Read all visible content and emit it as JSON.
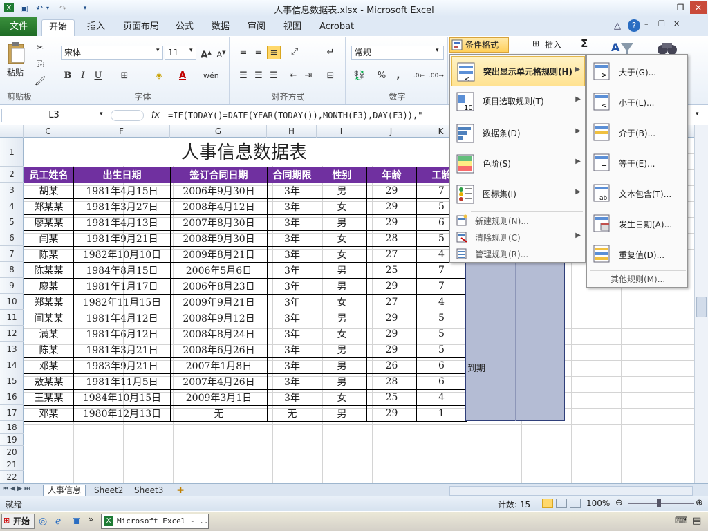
{
  "window": {
    "title": "人事信息数据表.xlsx - Microsoft Excel"
  },
  "ribbon_tabs": [
    "文件",
    "开始",
    "插入",
    "页面布局",
    "公式",
    "数据",
    "审阅",
    "视图",
    "Acrobat"
  ],
  "ribbon": {
    "paste_label": "粘贴",
    "clipboard_label": "剪贴板",
    "font_label": "字体",
    "align_label": "对齐方式",
    "number_label": "数字",
    "font_name": "宋体",
    "font_size": "11",
    "number_format": "常规",
    "cond_format_label": "条件格式",
    "insert_label": "插入",
    "sigma": "Σ",
    "bold": "B",
    "italic": "I",
    "underline": "U",
    "font_color": "A",
    "percent": "%",
    "comma": ","
  },
  "formula_bar": {
    "cell_ref": "L3",
    "fx": "fx",
    "formula": "=IF(TODAY()=DATE(YEAR(TODAY()),MONTH(F3),DAY(F3)),\""
  },
  "columns": [
    "C",
    "F",
    "G",
    "H",
    "I",
    "J",
    "K"
  ],
  "rows": [
    "1",
    "2",
    "3",
    "4",
    "5",
    "6",
    "7",
    "8",
    "9",
    "10",
    "11",
    "12",
    "13",
    "14",
    "15",
    "16",
    "17",
    "18",
    "19",
    "20",
    "21",
    "22"
  ],
  "sheet": {
    "title": "人事信息数据表",
    "headers": [
      "员工姓名",
      "出生日期",
      "签订合同日期",
      "合同期限",
      "性别",
      "年龄",
      "工龄"
    ],
    "rows": [
      [
        "胡某",
        "1981年4月15日",
        "2006年9月30日",
        "3年",
        "男",
        "29",
        "7"
      ],
      [
        "郑某某",
        "1981年3月27日",
        "2008年4月12日",
        "3年",
        "女",
        "29",
        "5"
      ],
      [
        "廖某某",
        "1981年4月13日",
        "2007年8月30日",
        "3年",
        "男",
        "29",
        "6"
      ],
      [
        "闫某",
        "1981年9月21日",
        "2008年9月30日",
        "3年",
        "女",
        "28",
        "5"
      ],
      [
        "陈某",
        "1982年10月10日",
        "2009年8月21日",
        "3年",
        "女",
        "27",
        "4"
      ],
      [
        "陈某某",
        "1984年8月15日",
        "2006年5月6日",
        "3年",
        "男",
        "25",
        "7"
      ],
      [
        "廖某",
        "1981年1月17日",
        "2006年8月23日",
        "3年",
        "男",
        "29",
        "7"
      ],
      [
        "郑某某",
        "1982年11月15日",
        "2009年9月21日",
        "3年",
        "女",
        "27",
        "4"
      ],
      [
        "闫某某",
        "1981年4月12日",
        "2008年9月12日",
        "3年",
        "男",
        "29",
        "5"
      ],
      [
        "满某",
        "1981年6月12日",
        "2008年8月24日",
        "3年",
        "女",
        "29",
        "5"
      ],
      [
        "陈某",
        "1981年3月21日",
        "2008年6月26日",
        "3年",
        "男",
        "29",
        "5"
      ],
      [
        "邓某",
        "1983年9月21日",
        "2007年1月8日",
        "3年",
        "男",
        "26",
        "6"
      ],
      [
        "敖某某",
        "1981年11月5日",
        "2007年4月26日",
        "3年",
        "男",
        "28",
        "6"
      ],
      [
        "王某某",
        "1984年10月15日",
        "2009年3月1日",
        "3年",
        "女",
        "25",
        "4"
      ],
      [
        "邓某",
        "1980年12月13日",
        "无",
        "无",
        "男",
        "29",
        "1"
      ]
    ],
    "overflow_text": "到期"
  },
  "menu_main": [
    {
      "label": "突出显示单元格规则(H)",
      "icon": "highlight-rules-icon"
    },
    {
      "label": "项目选取规则(T)",
      "icon": "top-bottom-rules-icon"
    },
    {
      "label": "数据条(D)",
      "icon": "data-bars-icon"
    },
    {
      "label": "色阶(S)",
      "icon": "color-scales-icon"
    },
    {
      "label": "图标集(I)",
      "icon": "icon-sets-icon"
    }
  ],
  "menu_small": [
    {
      "label": "新建规则(N)...",
      "icon": "new-rule-icon"
    },
    {
      "label": "清除规则(C)",
      "icon": "clear-rules-icon"
    },
    {
      "label": "管理规则(R)...",
      "icon": "manage-rules-icon"
    }
  ],
  "menu_sub": [
    {
      "label": "大于(G)...",
      "icon": "greater-than-icon"
    },
    {
      "label": "小于(L)...",
      "icon": "less-than-icon"
    },
    {
      "label": "介于(B)...",
      "icon": "between-icon"
    },
    {
      "label": "等于(E)...",
      "icon": "equal-to-icon"
    },
    {
      "label": "文本包含(T)...",
      "icon": "text-contains-icon"
    },
    {
      "label": "发生日期(A)...",
      "icon": "date-occurring-icon"
    },
    {
      "label": "重复值(D)...",
      "icon": "duplicate-values-icon"
    }
  ],
  "menu_sub_more": "其他规则(M)...",
  "sheet_tabs": [
    "人事信息",
    "Sheet2",
    "Sheet3"
  ],
  "status": {
    "ready": "就绪",
    "count": "计数: 15",
    "zoom": "100%"
  },
  "taskbar": {
    "start": "开始",
    "app": "Microsoft Excel - ..."
  }
}
